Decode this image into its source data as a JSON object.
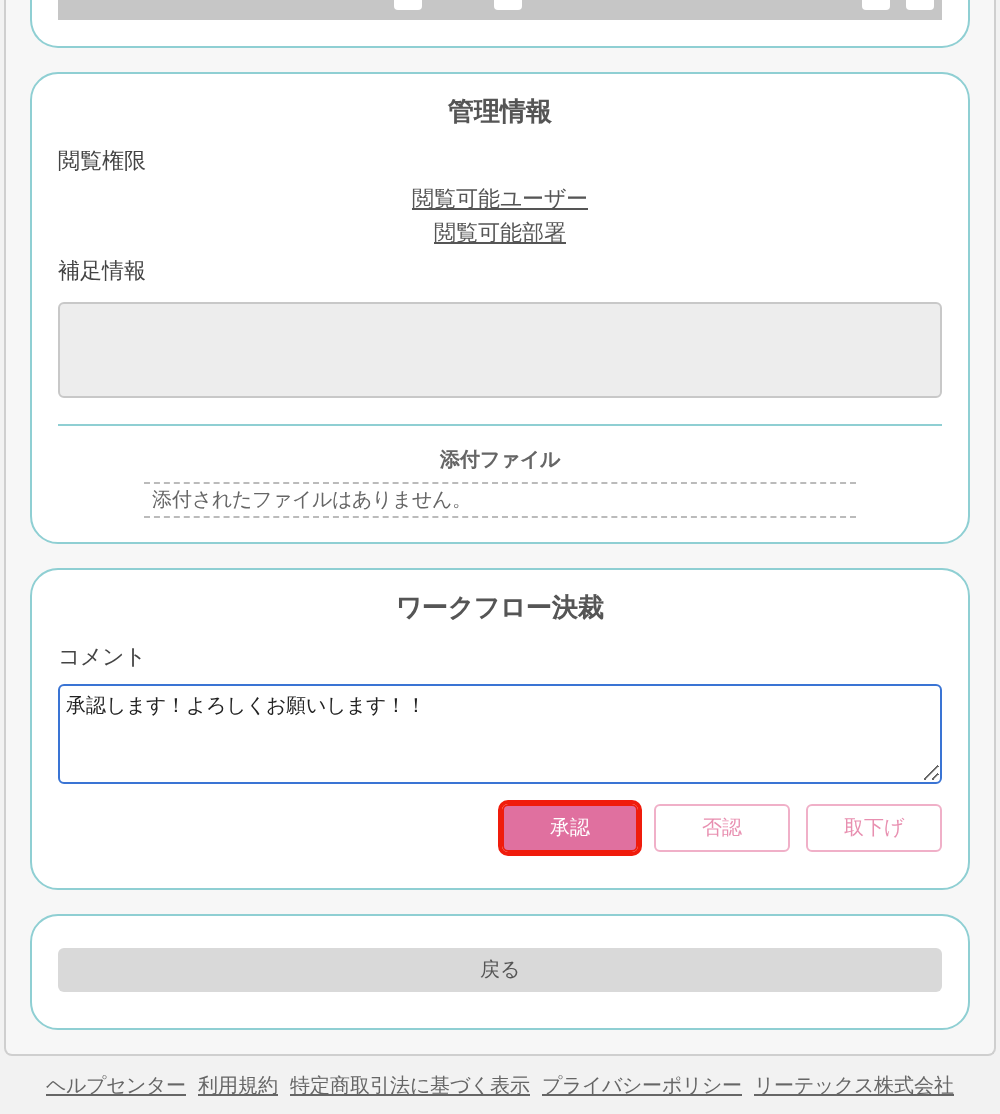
{
  "admin_section": {
    "title": "管理情報",
    "view_permission_label": "閲覧権限",
    "links": [
      "閲覧可能ユーザー",
      "閲覧可能部署"
    ],
    "supplement_label": "補足情報",
    "attachments": {
      "title": "添付ファイル",
      "empty_message": "添付されたファイルはありません。"
    }
  },
  "workflow_section": {
    "title": "ワークフロー決裁",
    "comment_label": "コメント",
    "comment_value": "承認します！よろしくお願いします！！",
    "buttons": [
      {
        "label": "承認",
        "kind": "filled",
        "highlighted": true
      },
      {
        "label": "否認",
        "kind": "outline",
        "highlighted": false
      },
      {
        "label": "取下げ",
        "kind": "outline",
        "highlighted": false
      }
    ]
  },
  "back_button": "戻る",
  "footer_links": [
    "ヘルプセンター",
    "利用規約",
    "特定商取引法に基づく表示",
    "プライバシーポリシー",
    "リーテックス株式会社"
  ]
}
